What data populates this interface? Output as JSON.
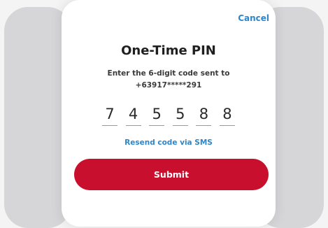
{
  "header": {
    "cancel_label": "Cancel"
  },
  "title": "One-Time PIN",
  "instructions": {
    "line1": "Enter the 6-digit code sent to",
    "line2": "+63917*****291"
  },
  "otp_digits": [
    "7",
    "4",
    "5",
    "5",
    "8",
    "8"
  ],
  "resend_label": "Resend code via SMS",
  "submit_label": "Submit",
  "colors": {
    "accent_link": "#2f86c8",
    "submit_button": "#c8102e"
  }
}
